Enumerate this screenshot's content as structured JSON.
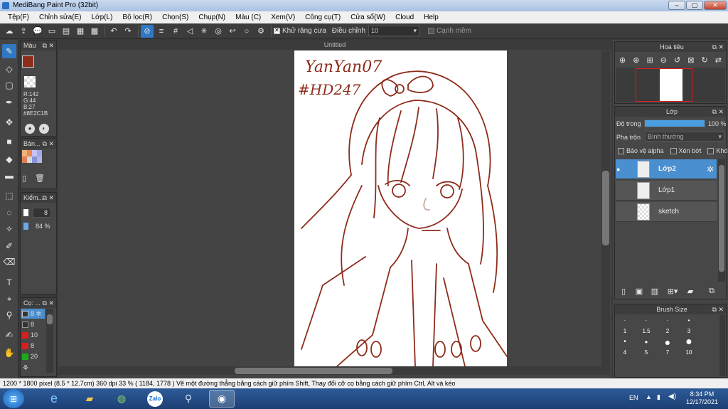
{
  "window": {
    "title": "MediBang Paint Pro (32bit)"
  },
  "menu": [
    "Tệp(F)",
    "Chỉnh sửa(E)",
    "Lớp(L)",
    "Bộ lọc(R)",
    "Chọn(S)",
    "Chụp(N)",
    "Màu (C)",
    "Xem(V)",
    "Công cụ(T)",
    "Cửa sổ(W)",
    "Cloud",
    "Help"
  ],
  "toolbar": {
    "antialias_label": "Khử răng cưa",
    "adjust_label": "Điều chỉnh",
    "adjust_value": "10",
    "edge_label": "Cạnh mềm"
  },
  "color_panel": {
    "title": "Màu",
    "r": "R:142",
    "g": "G:44",
    "b": "B:27",
    "hex": "#8E2C1B",
    "main_color": "#8E2C1B"
  },
  "palette_panel": {
    "title": "Bản..."
  },
  "brush_size_panel": {
    "title": "Kiểm...",
    "size": "8",
    "opacity": "84 %"
  },
  "brush_list_panel": {
    "title": "Cọ: ...",
    "items": [
      "8",
      "8",
      "10",
      "8",
      "20"
    ]
  },
  "document": {
    "tab": "Untitled",
    "text1": "YanYan07",
    "text2": "#HD247",
    "line_color": "#8E2C1B"
  },
  "navigator": {
    "title": "Hoa tiêu"
  },
  "layer_panel": {
    "title": "Lớp",
    "opacity_label": "Độ trong",
    "opacity_value": "100 %",
    "opacity_level": 1.0,
    "blend_label": "Pha trộn",
    "blend_value": "Bình thường",
    "protect_alpha": "Bảo vệ alpha",
    "clip": "Xén bớt",
    "lock": "Khóa",
    "layers": [
      "Lớp2",
      "Lớp1",
      "sketch"
    ]
  },
  "brush_size_list": {
    "title": "Brush Size",
    "sizes": [
      "1",
      "1.5",
      "2",
      "3",
      "4",
      "5",
      "7",
      "10"
    ]
  },
  "status": {
    "text": "1200 * 1800 pixel  (8.5 * 12.7cm)  360 dpi  33 %  ( 1184, 1778 )  Vẽ một đường thẳng bằng cách giữ phím Shift, Thay đổi cỡ cọ bằng cách giữ phím Ctrl, Alt và kéo"
  },
  "taskbar": {
    "lang": "EN",
    "time": "8:34 PM",
    "date": "12/17/2021",
    "zalo": "Zalo"
  }
}
